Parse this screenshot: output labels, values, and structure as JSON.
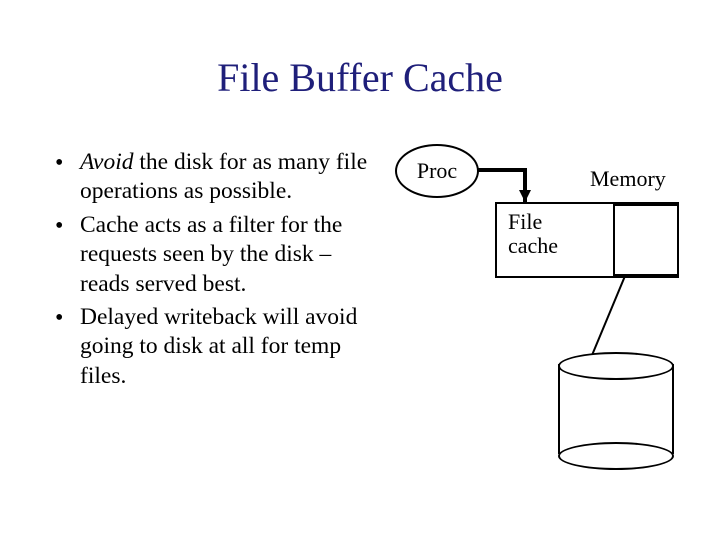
{
  "title": "File Buffer Cache",
  "bullets": [
    {
      "emphasis": "Avoid",
      "rest": " the disk for as many file operations as possible."
    },
    {
      "emphasis": "",
      "rest": "Cache acts as a filter for the requests seen by the disk – reads served best."
    },
    {
      "emphasis": "",
      "rest": "Delayed writeback will avoid going to disk at all for temp files."
    }
  ],
  "diagram": {
    "proc_label": "Proc",
    "memory_label": "Memory",
    "filecache_label_line1": "File",
    "filecache_label_line2": "cache"
  }
}
